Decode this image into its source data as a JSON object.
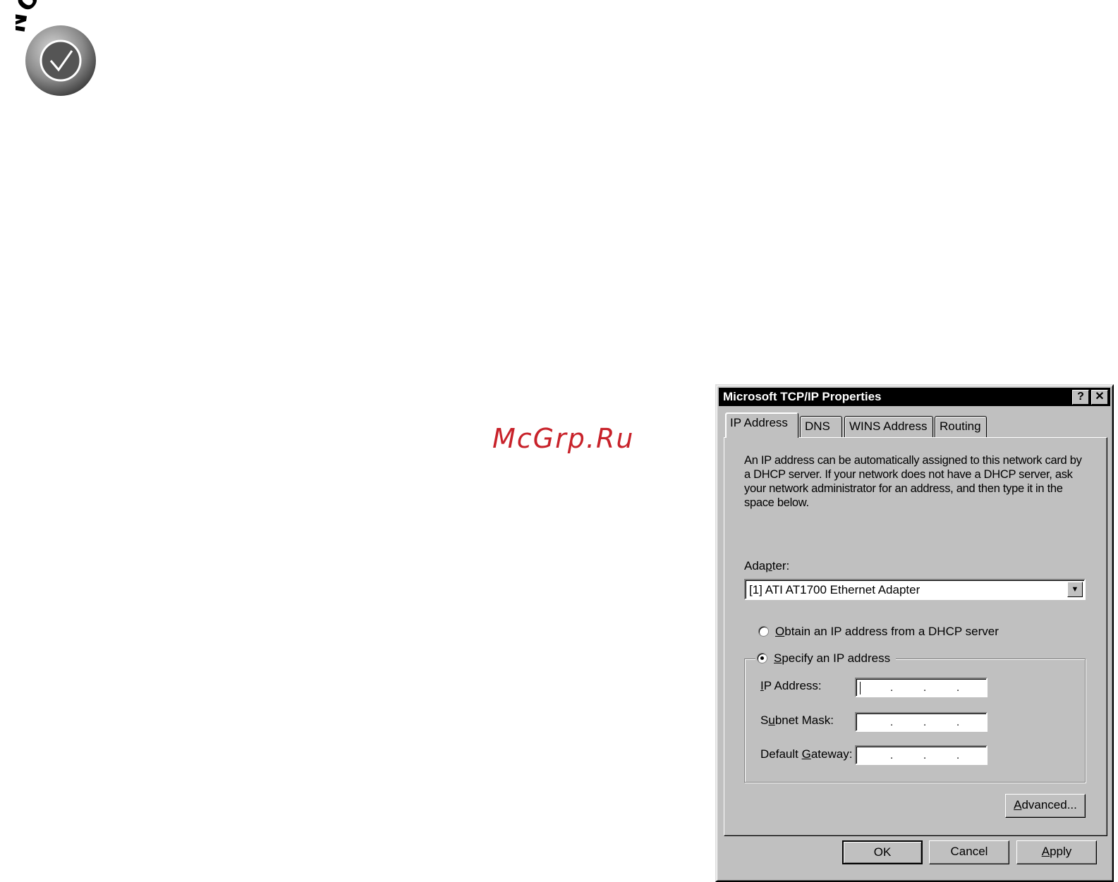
{
  "note": {
    "label": "NOTE"
  },
  "watermark": {
    "text": "McGrp.Ru"
  },
  "dialog": {
    "title": "Microsoft TCP/IP Properties",
    "help_button": "?",
    "close_button": "✕",
    "tabs": [
      {
        "label": "IP Address",
        "selected": true
      },
      {
        "label": "DNS"
      },
      {
        "label": "WINS Address"
      },
      {
        "label": "Routing"
      }
    ],
    "intro_text": "An IP address can be automatically assigned to this network card by a DHCP server.  If your network does not have a DHCP server, ask your network administrator for an address, and then type it in the space below.",
    "adapter": {
      "label": "Adapter:",
      "value": "[1]  ATI AT1700 Ethernet Adapter"
    },
    "radio_dhcp": {
      "label": "Obtain an IP address from a DHCP server",
      "checked": false
    },
    "radio_specify": {
      "label": "Specify an IP address",
      "checked": true
    },
    "fields": {
      "ip_address": {
        "label": "IP Address:",
        "value": ""
      },
      "subnet_mask": {
        "label": "Subnet Mask:",
        "value": ""
      },
      "default_gateway": {
        "label": "Default Gateway:",
        "value": ""
      }
    },
    "advanced_label": "Advanced...",
    "ok_label": "OK",
    "cancel_label": "Cancel",
    "apply_label": "Apply"
  }
}
